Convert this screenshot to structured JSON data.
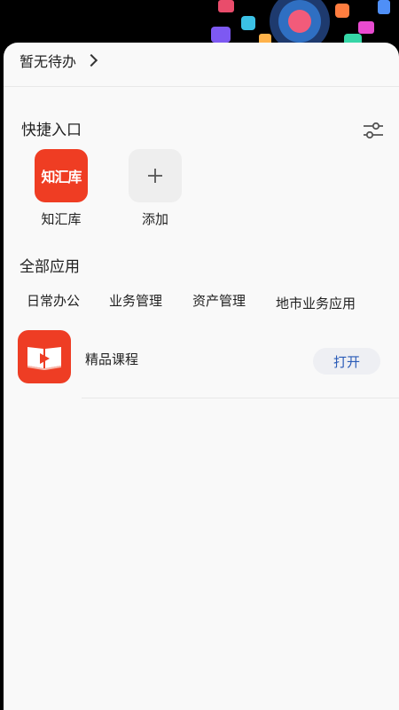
{
  "todo": {
    "label": "暂无待办"
  },
  "shortcuts": {
    "title": "快捷入口",
    "items": [
      {
        "tile_text": "知汇库",
        "label": "知汇库",
        "color": "#ef3d23"
      },
      {
        "label": "添加"
      }
    ]
  },
  "all_apps": {
    "title": "全部应用",
    "tabs": [
      "日常办公",
      "业务管理",
      "资产管理",
      "地市业务应用"
    ],
    "apps": [
      {
        "name": "精品课程",
        "action": "打开",
        "icon": "open-book-play-icon",
        "color": "#ee3d24"
      }
    ]
  },
  "colors": {
    "accent": "#2a5bb7",
    "brand_red": "#ef3d23"
  }
}
